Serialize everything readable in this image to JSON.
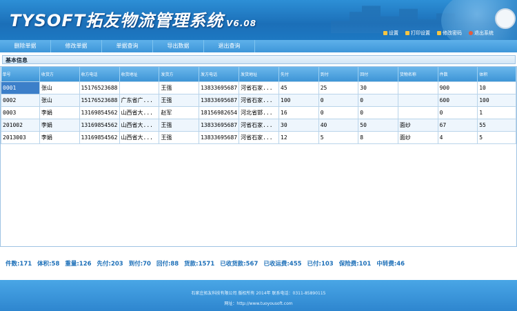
{
  "header": {
    "logo_text": "TYSOFT拓友物流管理系统",
    "version": "V6.08",
    "links": [
      {
        "label": "设置",
        "icon": "settings-icon"
      },
      {
        "label": "打印设置",
        "icon": "printer-icon"
      },
      {
        "label": "修改密码",
        "icon": "pencil-icon"
      },
      {
        "label": "退出系统",
        "icon": "power-icon"
      }
    ]
  },
  "nav": {
    "items": [
      "删除单据",
      "修改单据",
      "单据查询",
      "导出数据",
      "退出查询"
    ]
  },
  "section_title": "基本信息",
  "table": {
    "columns": [
      "单号",
      "收货方",
      "收方电话",
      "收货地址",
      "发货方",
      "发方电话",
      "发货地址",
      "先付",
      "到付",
      "回付",
      "货物名称",
      "件数",
      "体积"
    ],
    "rows": [
      [
        "0001",
        "张山",
        "15176523688",
        "",
        "王强",
        "13833695687",
        "河省石家...",
        "45",
        "25",
        "30",
        "",
        "900",
        "10"
      ],
      [
        "0002",
        "张山",
        "15176523688",
        "广东省广...",
        "王强",
        "13833695687",
        "河省石家...",
        "100",
        "0",
        "0",
        "",
        "600",
        "100"
      ],
      [
        "0003",
        "李娟",
        "13169854562",
        "山西省大...",
        "赵军",
        "18156982654",
        "河北省邯...",
        "16",
        "0",
        "0",
        "",
        "0",
        "1"
      ],
      [
        "201002",
        "李娟",
        "13169854562",
        "山西省大...",
        "王强",
        "13833695687",
        "河省石家...",
        "30",
        "40",
        "50",
        "面纱",
        "67",
        "55"
      ],
      [
        "2013003",
        "李娟",
        "13169854562",
        "山西省大...",
        "王强",
        "13833695687",
        "河省石家...",
        "12",
        "5",
        "8",
        "面纱",
        "4",
        "5"
      ]
    ]
  },
  "stats": [
    "件数:171",
    "体积:58",
    "重量:126",
    "先付:203",
    "到付:70",
    "回付:88",
    "货款:1571",
    "已收货款:567",
    "已收运费:455",
    "已付:103",
    "保险费:101",
    "中转费:46"
  ],
  "footer": {
    "line1": "石家庄拓友科技有限公司 版权所有 2014年 联系电话：0311-85890115",
    "line2": "网址：http://www.tuoyousoft.com"
  }
}
